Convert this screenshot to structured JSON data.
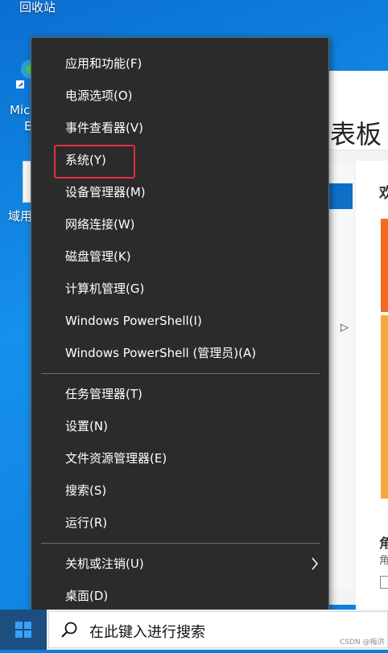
{
  "desktop": {
    "recycle_bin_label": "回收站",
    "edge_label_line1": "Mic",
    "edge_label_line2": "E",
    "file_label": "域用"
  },
  "background_window": {
    "header_text": "表板",
    "welcome_text": "欢",
    "bottom_text1": "角",
    "bottom_text2": "角"
  },
  "menu": {
    "items": [
      {
        "label": "应用和功能(F)"
      },
      {
        "label": "电源选项(O)"
      },
      {
        "label": "事件查看器(V)"
      },
      {
        "label": "系统(Y)"
      },
      {
        "label": "设备管理器(M)"
      },
      {
        "label": "网络连接(W)"
      },
      {
        "label": "磁盘管理(K)"
      },
      {
        "label": "计算机管理(G)"
      },
      {
        "label": "Windows PowerShell(I)"
      },
      {
        "label": "Windows PowerShell (管理员)(A)"
      },
      {
        "label": "任务管理器(T)"
      },
      {
        "label": "设置(N)"
      },
      {
        "label": "文件资源管理器(E)"
      },
      {
        "label": "搜索(S)"
      },
      {
        "label": "运行(R)"
      },
      {
        "label": "关机或注销(U)"
      },
      {
        "label": "桌面(D)"
      }
    ],
    "highlighted_item": "系统(Y)",
    "highlight_color": "#e0303f"
  },
  "taskbar": {
    "search_placeholder": "在此键入进行搜索",
    "start_icon": "windows-logo-icon",
    "search_icon": "search-icon"
  },
  "watermark": "CSDN @梅洪"
}
